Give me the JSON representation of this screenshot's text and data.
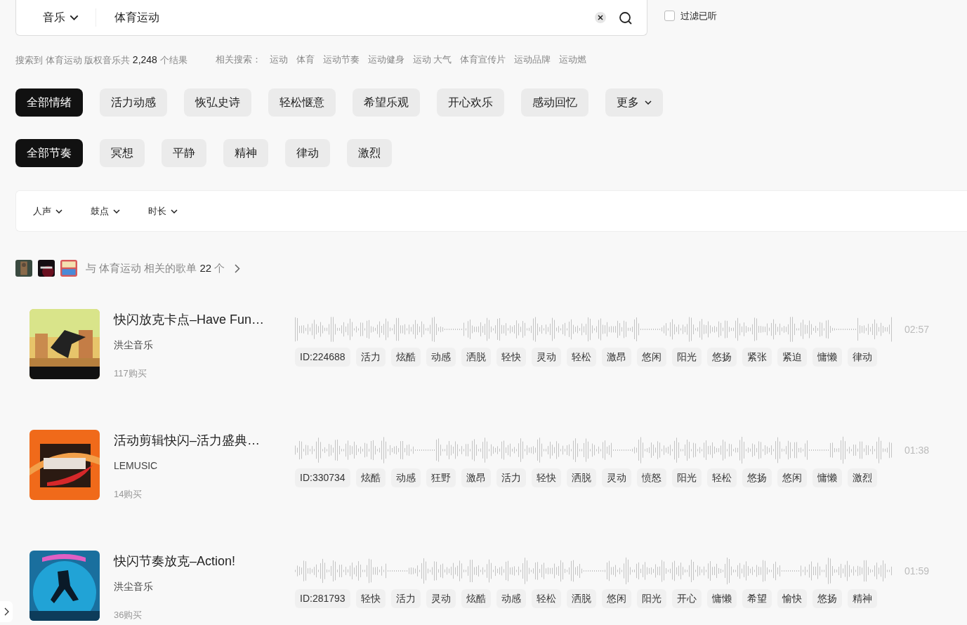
{
  "search": {
    "category": "音乐",
    "query": "体育运动"
  },
  "filter_heard": {
    "label": "过滤已听",
    "checked": false
  },
  "summary": "搜索到 体育运动 版权音乐共 **2,248** 个结果",
  "related": {
    "label": "相关搜索：",
    "items": [
      "运动",
      "体育",
      "运动节奏",
      "运动健身",
      "运动 大气",
      "体育宣传片",
      "运动品牌",
      "运动燃"
    ]
  },
  "moods": [
    {
      "label": "全部情绪",
      "selected": true
    },
    {
      "label": "活力动感",
      "selected": false
    },
    {
      "label": "恢弘史诗",
      "selected": false
    },
    {
      "label": "轻松惬意",
      "selected": false
    },
    {
      "label": "希望乐观",
      "selected": false
    },
    {
      "label": "开心欢乐",
      "selected": false
    },
    {
      "label": "感动回忆",
      "selected": false
    }
  ],
  "more": "更多",
  "rhythms": [
    {
      "label": "全部节奏",
      "selected": true
    },
    {
      "label": "冥想",
      "selected": false
    },
    {
      "label": "平静",
      "selected": false
    },
    {
      "label": "精神",
      "selected": false
    },
    {
      "label": "律动",
      "selected": false
    },
    {
      "label": "激烈",
      "selected": false
    }
  ],
  "filters": [
    "人声",
    "鼓点",
    "时长"
  ],
  "playlists": "与 体育运动 相关的歌单 **22** 个",
  "tracks": [
    {
      "title": "快闪放克卡点–Have Fun…",
      "artist": "洪尘音乐",
      "purchases": "117购买",
      "duration": "02:57",
      "id": "ID:224688",
      "tags": [
        "活力",
        "炫酷",
        "动感",
        "洒脱",
        "轻快",
        "灵动",
        "轻松",
        "激昂",
        "悠闲",
        "阳光",
        "悠扬",
        "紧张",
        "紧迫",
        "慵懒",
        "律动"
      ]
    },
    {
      "title": "活动剪辑快闪–活力盛典…",
      "artist": "LEMUSIC",
      "purchases": "14购买",
      "duration": "01:38",
      "id": "ID:330734",
      "tags": [
        "炫酷",
        "动感",
        "狂野",
        "激昂",
        "活力",
        "轻快",
        "洒脱",
        "灵动",
        "愤怒",
        "阳光",
        "轻松",
        "悠扬",
        "悠闲",
        "慵懒",
        "激烈"
      ]
    },
    {
      "title": "快闪节奏放克–Action!",
      "artist": "洪尘音乐",
      "purchases": "36购买",
      "duration": "01:59",
      "id": "ID:281793",
      "tags": [
        "轻快",
        "活力",
        "灵动",
        "炫酷",
        "动感",
        "轻松",
        "洒脱",
        "悠闲",
        "阳光",
        "开心",
        "慵懒",
        "希望",
        "愉快",
        "悠扬",
        "精神"
      ]
    }
  ]
}
